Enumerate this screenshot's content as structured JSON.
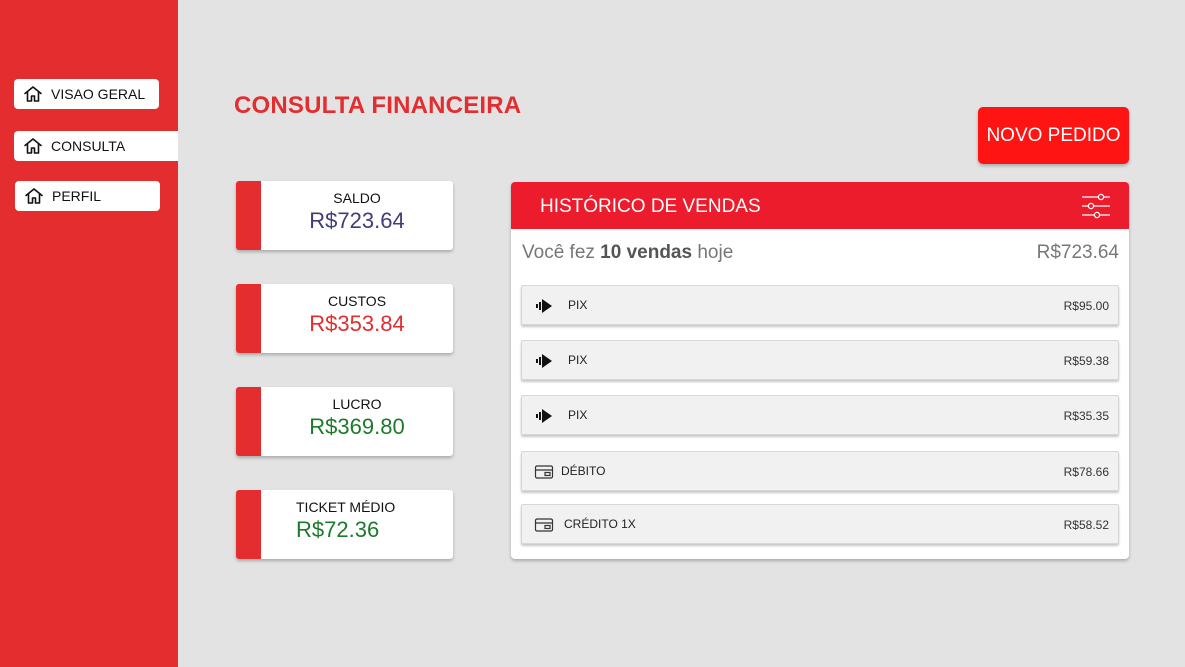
{
  "sidebar": {
    "items": [
      {
        "label": "VISAO GERAL",
        "icon": "home-icon"
      },
      {
        "label": "CONSULTA",
        "icon": "home-icon"
      },
      {
        "label": "PERFIL",
        "icon": "home-icon"
      }
    ],
    "active": "CONSULTA"
  },
  "title": {
    "light": "CONSULTA ",
    "bold": "FINANCEIRA"
  },
  "actions": {
    "new_order": "NOVO PEDIDO"
  },
  "stats": [
    {
      "label": "SALDO",
      "value": "R$723.64",
      "color": "#3f3d7a"
    },
    {
      "label": "CUSTOS",
      "value": "R$353.84",
      "color": "#e32d2f"
    },
    {
      "label": "LUCRO",
      "value": "R$369.80",
      "color": "#1e7a2b"
    },
    {
      "label": "TICKET MÉDIO",
      "value": "R$72.36",
      "color": "#1e7a2b"
    }
  ],
  "history": {
    "title": "HISTÓRICO DE VENDAS",
    "filter_icon": "sliders-icon",
    "summary": {
      "prefix": "Você fez ",
      "count": "10 vendas",
      "suffix": " hoje",
      "total": "R$723.64"
    },
    "transactions": [
      {
        "method": "PIX",
        "amount": "R$95.00",
        "icon": "pix-icon"
      },
      {
        "method": "PIX",
        "amount": "R$59.38",
        "icon": "pix-icon"
      },
      {
        "method": "PIX",
        "amount": "R$35.35",
        "icon": "pix-icon"
      },
      {
        "method": "DÉBITO",
        "amount": "R$78.66",
        "icon": "card-icon"
      },
      {
        "method": "CRÉDITO 1X",
        "amount": "R$58.52",
        "icon": "card-icon"
      }
    ]
  },
  "colors": {
    "brand_red": "#e32d2f",
    "button_red": "#ff1414",
    "header_red": "#ec1c2d",
    "background": "#e3e3e3"
  }
}
